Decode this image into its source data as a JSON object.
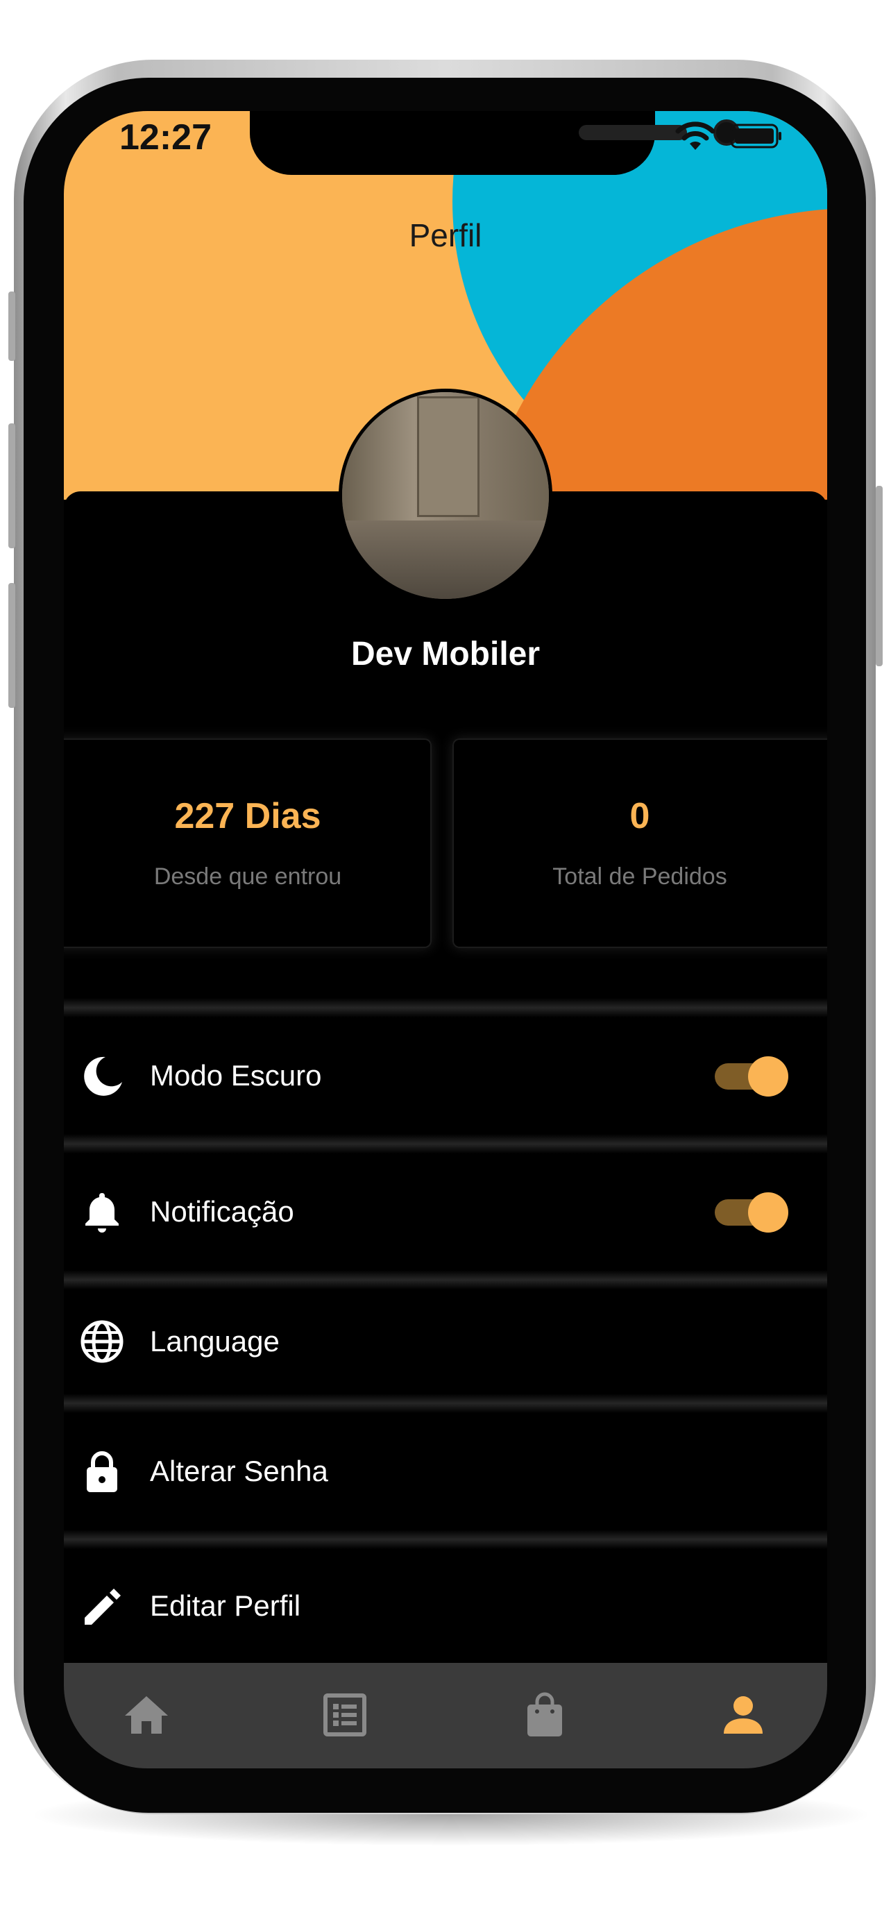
{
  "status_bar": {
    "time": "12:27"
  },
  "header": {
    "title": "Perfil"
  },
  "profile": {
    "name": "Dev Mobiler"
  },
  "stats": [
    {
      "value": "227 Dias",
      "label": "Desde que entrou"
    },
    {
      "value": "0",
      "label": "Total de Pedidos"
    }
  ],
  "menu": {
    "dark_mode": {
      "label": "Modo Escuro",
      "icon": "moon-icon",
      "toggle": true
    },
    "notification": {
      "label": "Notificação",
      "icon": "bell-icon",
      "toggle": true
    },
    "language": {
      "label": "Language",
      "icon": "globe-icon"
    },
    "change_password": {
      "label": "Alterar Senha",
      "icon": "lock-icon"
    },
    "edit_profile": {
      "label": "Editar Perfil",
      "icon": "pencil-icon"
    }
  },
  "bottom_nav": {
    "items": [
      {
        "icon": "home-icon",
        "active": false
      },
      {
        "icon": "list-icon",
        "active": false
      },
      {
        "icon": "shopping-bag-icon",
        "active": false
      },
      {
        "icon": "person-icon",
        "active": true
      }
    ]
  },
  "colors": {
    "accent": "#fbb454",
    "header_orange": "#ec7a25",
    "header_blue": "#05b6d7",
    "background": "#000000",
    "nav_background": "#3b3b3b",
    "nav_inactive": "#8a8a8a"
  }
}
